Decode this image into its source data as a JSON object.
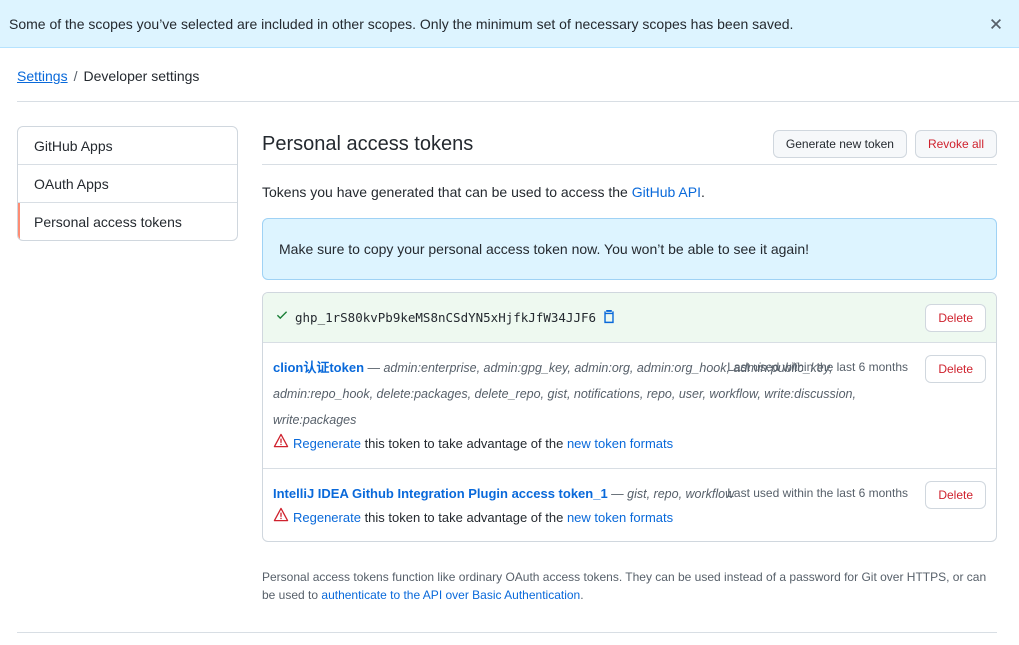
{
  "flash": {
    "message": "Some of the scopes you’ve selected are included in other scopes. Only the minimum set of necessary scopes has been saved.",
    "close_icon": "x-icon"
  },
  "breadcrumb": {
    "settings": "Settings",
    "separator": "/",
    "current": "Developer settings"
  },
  "sidebar": {
    "items": [
      {
        "label": "GitHub Apps"
      },
      {
        "label": "OAuth Apps"
      },
      {
        "label": "Personal access tokens",
        "selected": true
      }
    ],
    "selected_color": "#fd8c73"
  },
  "main": {
    "title": "Personal access tokens",
    "generate_label": "Generate new token",
    "revoke_label": "Revoke all",
    "description_prefix": "Tokens you have generated that can be used to access the ",
    "description_link": "GitHub API",
    "description_suffix": ".",
    "notice": "Make sure to copy your personal access token now. You won’t be able to see it again!",
    "new_token": {
      "value": "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",
      "delete_label": "Delete",
      "check_icon": "check-icon",
      "copy_icon": "clipboard-icon"
    },
    "tokens": [
      {
        "name": "clion认证token",
        "dash": " — ",
        "scopes": "admin:enterprise, admin:gpg_key, admin:org, admin:org_hook, admin:public_key, admin:repo_hook, delete:packages, delete_repo, gist, notifications, repo, user, workflow, write:discussion, write:packages",
        "last_used": "Last used within the last 6 months",
        "delete_label": "Delete",
        "regen_link": "Regenerate",
        "regen_text": " this token to take advantage of the ",
        "formats_link": "new token formats"
      },
      {
        "name": "IntelliJ IDEA Github Integration Plugin access token_1",
        "dash": " — ",
        "scopes": "gist, repo, workflow",
        "last_used": "Last used within the last 6 months",
        "delete_label": "Delete",
        "regen_link": "Regenerate",
        "regen_text": " this token to take advantage of the ",
        "formats_link": "new token formats"
      }
    ],
    "footnote_text": "Personal access tokens function like ordinary OAuth access tokens. They can be used instead of a password for Git over HTTPS, or can be used to ",
    "footnote_link": "authenticate to the API over Basic Authentication",
    "footnote_end": "."
  },
  "colors": {
    "link": "#0969da",
    "danger": "#cf222e",
    "success": "#1a7f37",
    "info_bg": "#ddf4ff"
  }
}
